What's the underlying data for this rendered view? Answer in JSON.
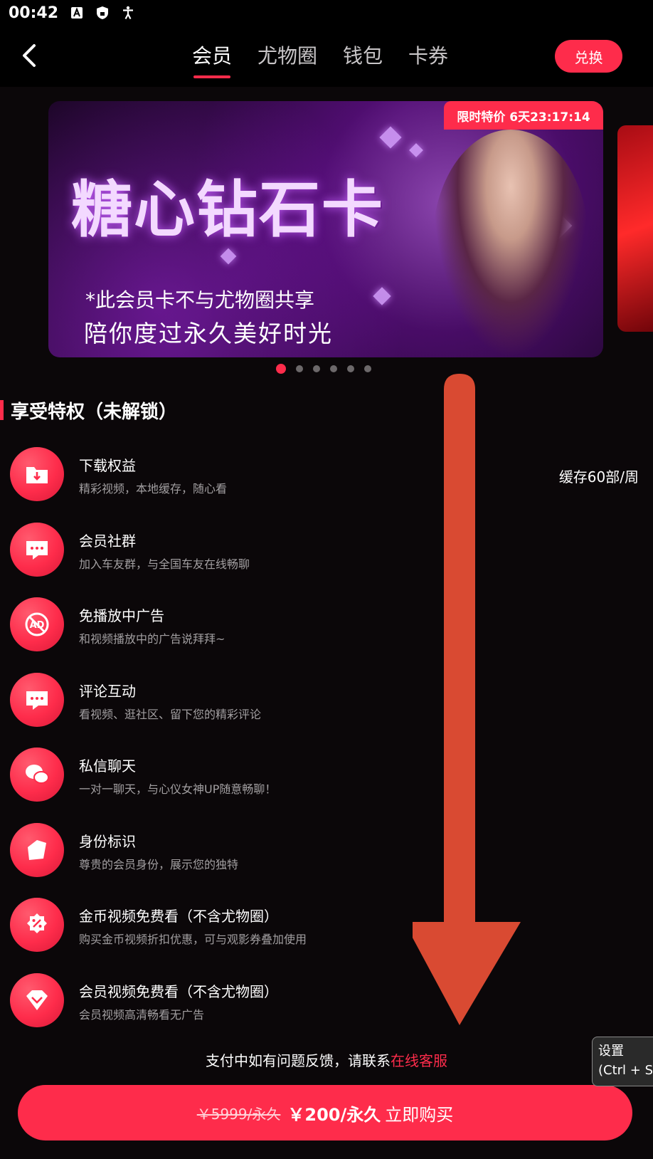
{
  "status_bar": {
    "time": "00:42",
    "icons": [
      "a-box-icon",
      "shield-icon",
      "accessibility-icon"
    ]
  },
  "header": {
    "tabs": [
      {
        "label": "会员",
        "active": true
      },
      {
        "label": "尤物圈",
        "active": false
      },
      {
        "label": "钱包",
        "active": false
      },
      {
        "label": "卡券",
        "active": false
      }
    ],
    "redeem_label": "兑换"
  },
  "banner": {
    "title": "糖心钻石卡",
    "note": "*此会员卡不与尤物圈共享",
    "subtitle": "陪你度过永久美好时光",
    "promo_badge": "限时特价 6天23:17:14",
    "dots_count": 6,
    "active_dot": 0
  },
  "privileges": {
    "section_title": "享受特权（未解锁）",
    "items": [
      {
        "icon": "download-folder-icon",
        "title": "下载权益",
        "desc": "精彩视频，本地缓存，随心看",
        "extra": "缓存60部/周"
      },
      {
        "icon": "chat-bubble-icon",
        "title": "会员社群",
        "desc": "加入车友群，与全国车友在线畅聊"
      },
      {
        "icon": "ad-block-icon",
        "title": "免播放中广告",
        "desc": "和视频播放中的广告说拜拜~"
      },
      {
        "icon": "comment-icon",
        "title": "评论互动",
        "desc": "看视频、逛社区、留下您的精彩评论"
      },
      {
        "icon": "private-message-icon",
        "title": "私信聊天",
        "desc": "一对一聊天，与心仪女神UP随意畅聊！"
      },
      {
        "icon": "identity-tag-icon",
        "title": "身份标识",
        "desc": "尊贵的会员身份，展示您的独特"
      },
      {
        "icon": "coin-discount-icon",
        "title": "金币视频免费看（不含尤物圈）",
        "desc": "购买金币视频折扣优惠，可与观影券叠加使用"
      },
      {
        "icon": "member-diamond-icon",
        "title": "会员视频免费看（不含尤物圈）",
        "desc": "会员视频高清畅看无广告"
      }
    ]
  },
  "footer": {
    "help_text": "支付中如有问题反馈，请联系",
    "help_link": "在线客服",
    "old_price": "￥5999/永久",
    "new_price": "￥200/永久",
    "buy_label": "立即购买"
  },
  "tooltip": {
    "line1": "设置",
    "line2": "(Ctrl + S"
  },
  "colors": {
    "accent": "#fe2c4b",
    "background": "#0b0709",
    "arrow": "#d94a32"
  }
}
